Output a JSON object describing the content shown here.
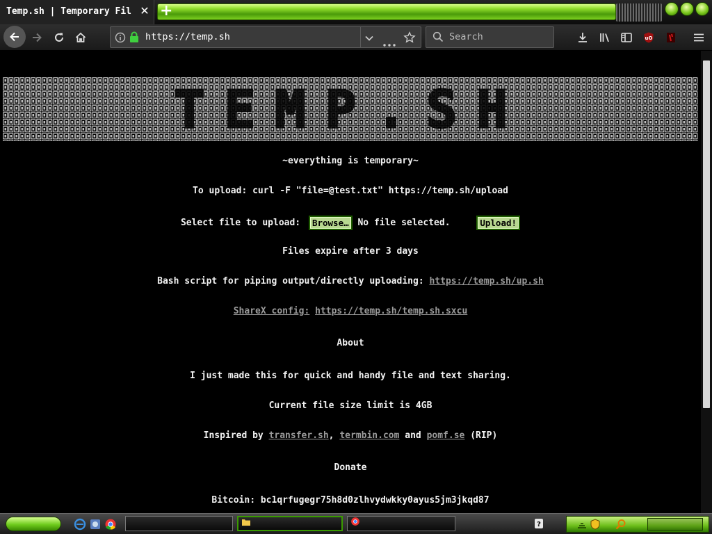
{
  "browser": {
    "tab": {
      "title": "Temp.sh | Temporary Fil"
    },
    "url": "https://temp.sh",
    "search_placeholder": "Search"
  },
  "page": {
    "banner_title": "TEMP.SH",
    "tagline": "~everything is temporary~",
    "upload_cmd": "To upload: curl -F \"file=@test.txt\" https://temp.sh/upload",
    "select_label": "Select file to upload:",
    "browse_label": "Browse…",
    "no_file": "No file selected.",
    "upload_label": "Upload!",
    "expire": "Files expire after 3 days",
    "bash_label": "Bash script for piping output/directly uploading:",
    "bash_link": "https://temp.sh/up.sh",
    "sharex_label": "ShareX config:",
    "sharex_link": "https://temp.sh/temp.sh.sxcu",
    "about_heading": "About",
    "about_text": "I just made this for quick and handy file and text sharing.",
    "size_limit": "Current file size limit is 4GB",
    "inspired_prefix": "Inspired by",
    "inspired_link1": "transfer.sh",
    "comma": ",",
    "inspired_link2": "termbin.com",
    "and_word": "and",
    "inspired_link3": "pomf.se",
    "rip": "(RIP)",
    "donate_heading": "Donate",
    "bitcoin": "Bitcoin: bc1qrfugegr75h8d0zlhvydwkky0ayus5jm3jkqd87"
  },
  "taskbar": {
    "task1": "",
    "task2": "",
    "task3": ""
  },
  "colors": {
    "accent": "#6fcb1c",
    "link": "#9a9a9a",
    "background": "#000000"
  },
  "icons": [
    "back-icon",
    "forward-icon",
    "reload-icon",
    "home-icon",
    "info-icon",
    "lock-icon",
    "chevron-down-icon",
    "more-icon",
    "star-icon",
    "search-icon",
    "download-icon",
    "library-icon",
    "sidebar-icon",
    "ublock-icon",
    "extension-icon",
    "menu-icon"
  ]
}
